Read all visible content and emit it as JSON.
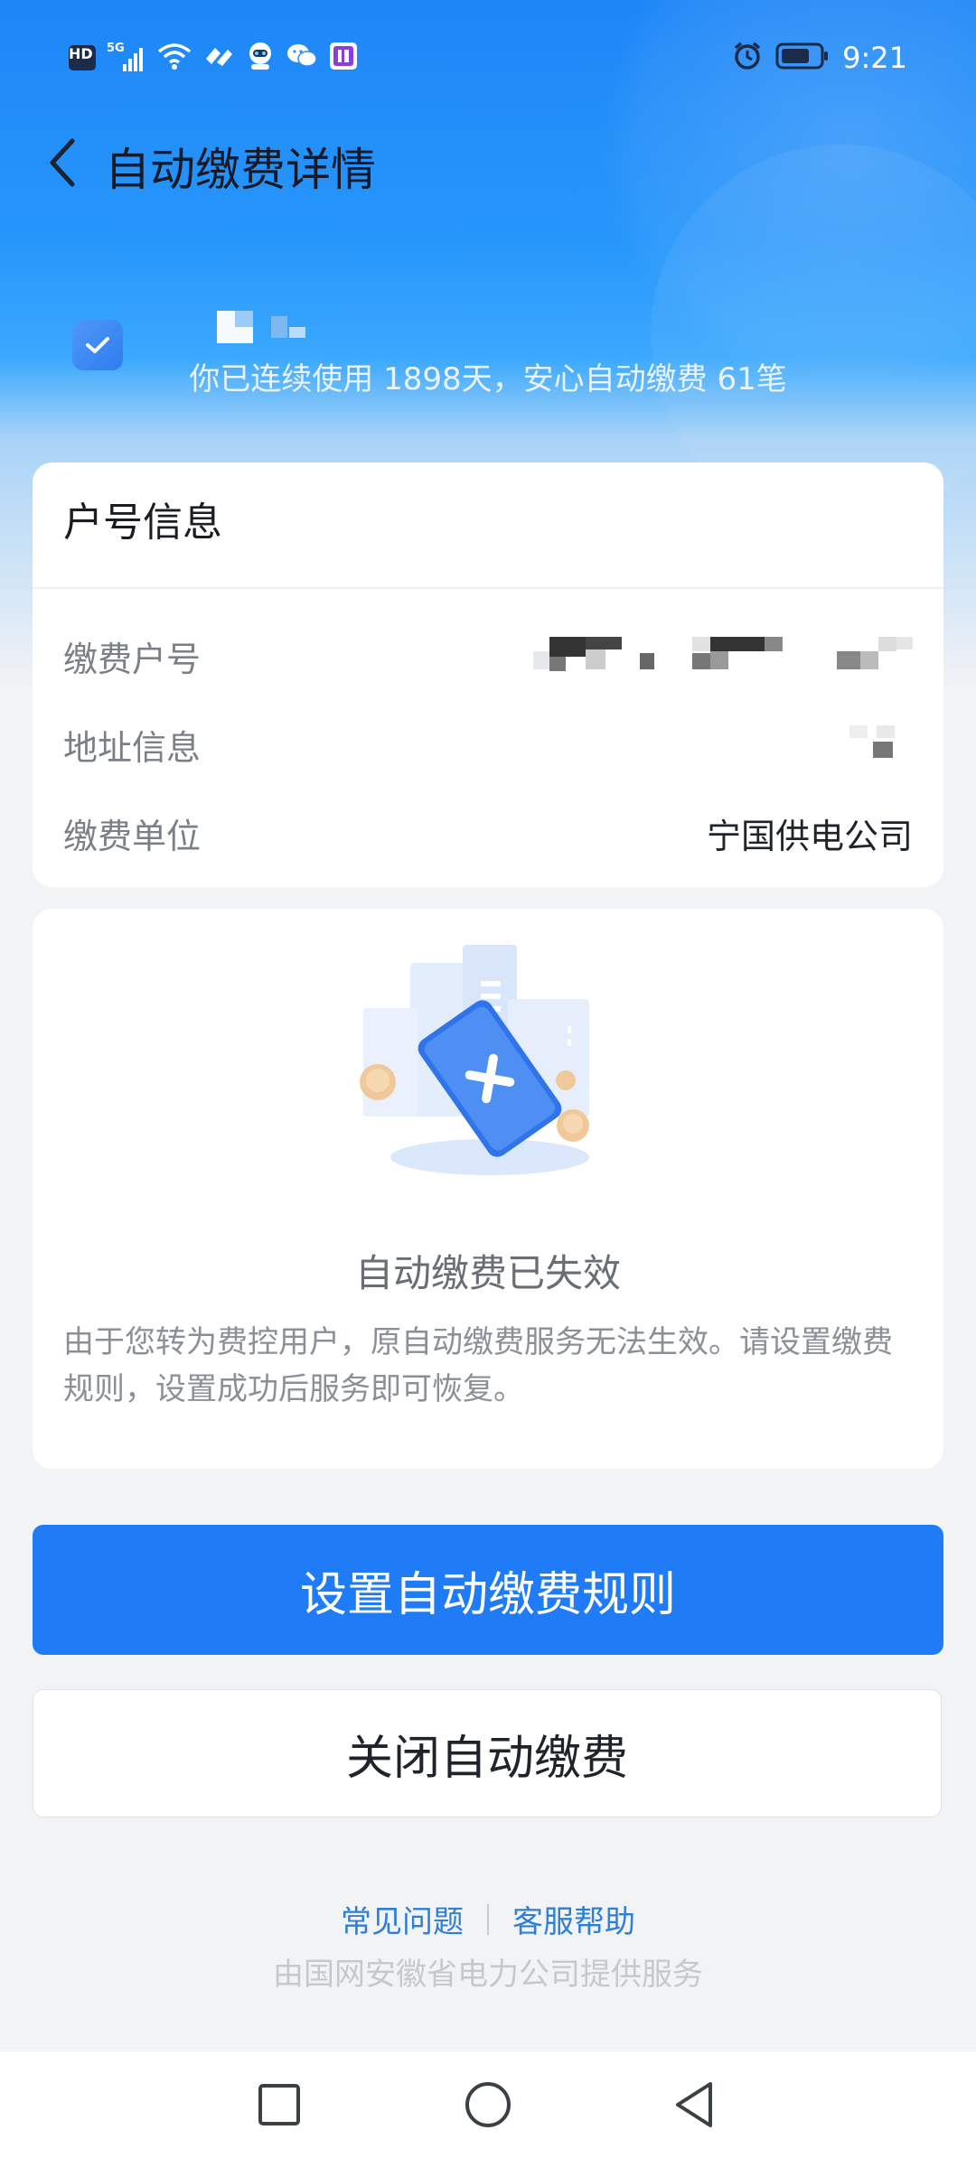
{
  "status_bar": {
    "time": "9:21",
    "network_label": "HD",
    "signal_label": "5G",
    "icons": [
      "hd-icon",
      "signal-5g-icon",
      "wifi-icon",
      "hifive-icon",
      "robot-app-icon",
      "wechat-icon",
      "store-app-icon",
      "alarm-icon",
      "battery-icon"
    ]
  },
  "header": {
    "title": "自动缴费详情",
    "back_icon": "chevron-left-icon"
  },
  "profile": {
    "usage_text": "你已连续使用 1898天，安心自动缴费 61笔"
  },
  "account_card": {
    "title": "户号信息",
    "rows": [
      {
        "label": "缴费户号",
        "value": ""
      },
      {
        "label": "地址信息",
        "value": ""
      },
      {
        "label": "缴费单位",
        "value": "宁国供电公司"
      }
    ]
  },
  "status_card": {
    "title": "自动缴费已失效",
    "description": "由于您转为费控用户，原自动缴费服务无法生效。请设置缴费规则，设置成功后服务即可恢复。"
  },
  "actions": {
    "primary_label": "设置自动缴费规则",
    "secondary_label": "关闭自动缴费"
  },
  "footer": {
    "faq_label": "常见问题",
    "support_label": "客服帮助",
    "provider_text": "由国网安徽省电力公司提供服务"
  },
  "colors": {
    "primary": "#1f7cf6",
    "header_gradient_top": "#1e86f7",
    "page_bg": "#f2f3f5",
    "link": "#2f7fd6"
  }
}
